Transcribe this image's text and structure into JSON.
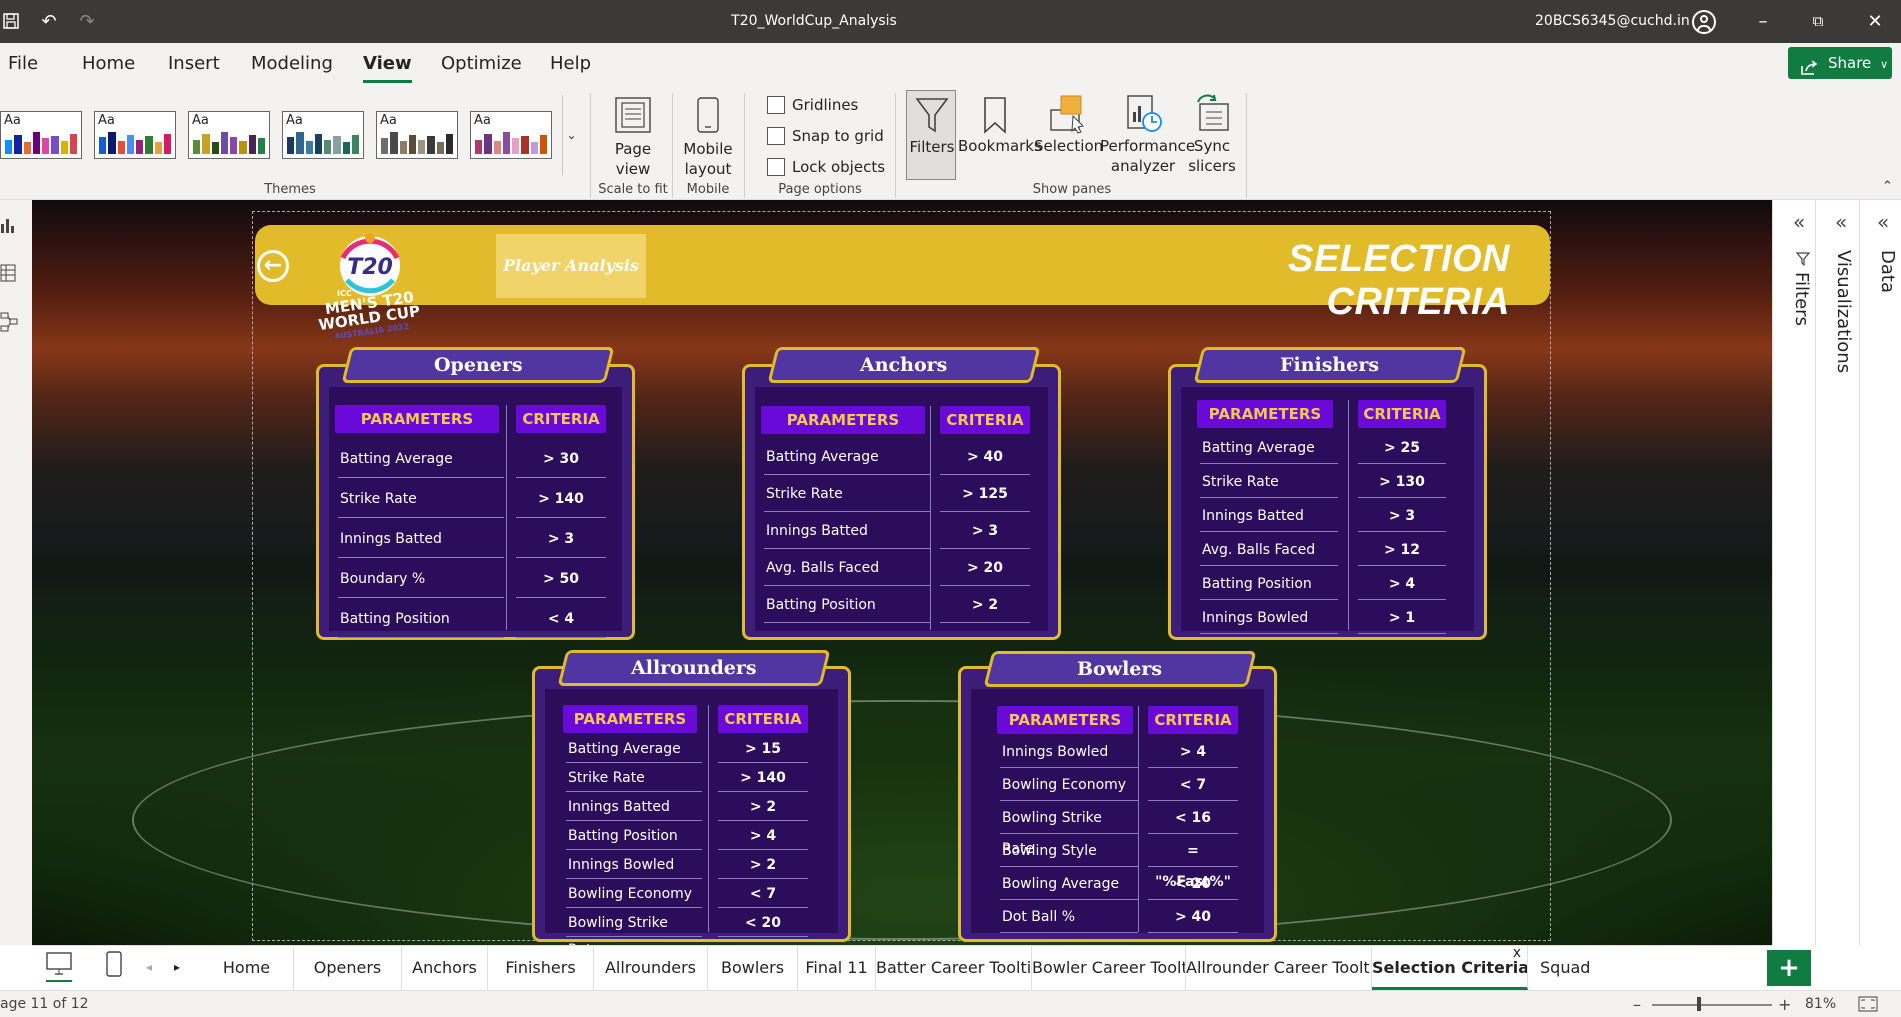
{
  "titlebar": {
    "title": "T20_WorldCup_Analysis",
    "user": "20BCS6345@cuchd.in"
  },
  "menu": {
    "items": [
      "File",
      "Home",
      "Insert",
      "Modeling",
      "View",
      "Optimize",
      "Help"
    ],
    "active": "View",
    "share": "Share"
  },
  "ribbon": {
    "themes_label": "Themes",
    "theme_aa": "Aa",
    "page_view": "Page view",
    "scale_to_fit": "Scale to fit",
    "mobile_layout": "Mobile layout",
    "mobile": "Mobile",
    "gridlines": "Gridlines",
    "snap_to_grid": "Snap to grid",
    "lock_objects": "Lock objects",
    "page_options": "Page options",
    "filters": "Filters",
    "bookmarks": "Bookmarks",
    "selection": "Selection",
    "performance_analyzer": "Performance analyzer",
    "sync_slicers": "Sync slicers",
    "show_panes": "Show panes"
  },
  "panes": {
    "filters": "Filters",
    "visualizations": "Visualizations",
    "data": "Data"
  },
  "report": {
    "player_analysis": "Player Analysis",
    "title": "SELECTION CRITERIA",
    "logo": {
      "icc": "ICC",
      "line1": "MEN'S T20",
      "line2": "WORLD CUP",
      "line3": "AUSTRALIA 2022",
      "mark": "T20"
    },
    "param_header": "PARAMETERS",
    "crit_header": "CRITERIA",
    "panels": [
      {
        "name": "Openers",
        "rows": [
          [
            "Batting Average",
            "> 30"
          ],
          [
            "Strike Rate",
            "> 140"
          ],
          [
            "Innings Batted",
            "> 3"
          ],
          [
            "Boundary %",
            "> 50"
          ],
          [
            "Batting Position",
            "< 4"
          ]
        ]
      },
      {
        "name": "Anchors",
        "rows": [
          [
            "Batting Average",
            "> 40"
          ],
          [
            "Strike Rate",
            "> 125"
          ],
          [
            "Innings Batted",
            "> 3"
          ],
          [
            "Avg. Balls Faced",
            "> 20"
          ],
          [
            "Batting Position",
            "> 2"
          ]
        ]
      },
      {
        "name": "Finishers",
        "rows": [
          [
            "Batting Average",
            "> 25"
          ],
          [
            "Strike Rate",
            "> 130"
          ],
          [
            "Innings Batted",
            "> 3"
          ],
          [
            "Avg. Balls Faced",
            "> 12"
          ],
          [
            "Batting Position",
            "> 4"
          ],
          [
            "Innings Bowled",
            "> 1"
          ]
        ]
      },
      {
        "name": "Allrounders",
        "rows": [
          [
            "Batting Average",
            "> 15"
          ],
          [
            "Strike Rate",
            "> 140"
          ],
          [
            "Innings Batted",
            "> 2"
          ],
          [
            "Batting Position",
            "> 4"
          ],
          [
            "Innings Bowled",
            "> 2"
          ],
          [
            "Bowling Economy",
            "< 7"
          ],
          [
            "Bowling Strike Rate",
            "< 20"
          ]
        ]
      },
      {
        "name": "Bowlers",
        "rows": [
          [
            "Innings Bowled",
            "> 4"
          ],
          [
            "Bowling Economy",
            "< 7"
          ],
          [
            "Bowling Strike Rate",
            "< 16"
          ],
          [
            "Bowling Style",
            "= \"%Fast%\""
          ],
          [
            "Bowling Average",
            "< 20"
          ],
          [
            "Dot Ball %",
            "> 40"
          ]
        ]
      }
    ]
  },
  "pagetabs": {
    "items": [
      "Home",
      "Openers",
      "Anchors",
      "Finishers",
      "Allrounders",
      "Bowlers",
      "Final 11",
      "Batter Career Tooltip",
      "Bowler Career Tooltip",
      "Allrounder Career Tooltip",
      "Selection Criteria",
      "Squad"
    ],
    "active": "Selection Criteria",
    "close": "x"
  },
  "status": {
    "page": "age 11 of 12",
    "zoom": "81%"
  },
  "colors": {
    "accent": "#107c41",
    "gold": "#e2bb2b",
    "purple": "#3d1d7a",
    "header": "#6a0ad8"
  }
}
